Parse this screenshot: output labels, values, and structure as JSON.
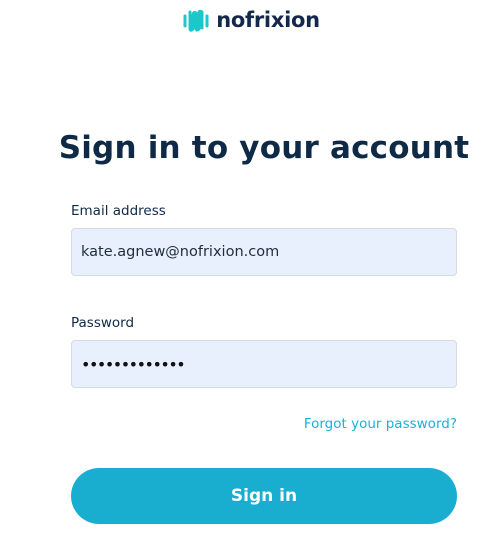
{
  "brand": {
    "name": "nofrixion",
    "logo_icon": "nofrixion-wave-logo-icon",
    "logo_color": "#1cc7c9",
    "name_color": "#13284a"
  },
  "heading": {
    "title": "Sign in to your account"
  },
  "form": {
    "email_label": "Email address",
    "email_value": "kate.agnew@nofrixion.com",
    "password_label": "Password",
    "password_masked": "•••••••••••••",
    "forgot_link": "Forgot your password?",
    "submit_label": "Sign in"
  },
  "colors": {
    "accent": "#19aecf",
    "link": "#19b2d3",
    "heading": "#0e2a47",
    "field_background": "#e8f0fe"
  }
}
